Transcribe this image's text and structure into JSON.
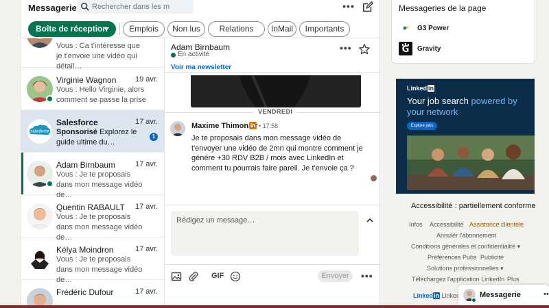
{
  "header": {
    "title": "Messagerie",
    "search_placeholder": "Rechercher dans les m",
    "more_label": "•••"
  },
  "filters": {
    "inbox_label": "Boîte de réception",
    "chips": [
      "Emplois",
      "Non lus",
      "Relations",
      "InMail",
      "Importants"
    ]
  },
  "conversations": [
    {
      "name": "",
      "date": "",
      "preview": "Vous : Ca t'intéresse que je t'envoie une vidéo qui détail…"
    },
    {
      "name": "Virginie Wagnon",
      "date": "19 avr.",
      "preview": "Vous : Hello Virginie, alors comment se passe la prise …"
    },
    {
      "name": "Salesforce",
      "date": "17 avr.",
      "sponsored": "Sponsorisé",
      "preview_rest": "Explorez le guide ultime du…",
      "unread": "1"
    },
    {
      "name": "Adam Birnbaum",
      "date": "17 avr.",
      "preview": "Vous : Je te proposais dans mon message vidéo de…"
    },
    {
      "name": "Quentin RABAULT",
      "date": "17 avr.",
      "preview": "Vous : Je te proposais dans mon message vidéo de…"
    },
    {
      "name": "Kélya Moindron",
      "date": "17 avr.",
      "preview": "Vous : Je te proposais dans mon message vidéo de…"
    },
    {
      "name": "Frédéric Dufour",
      "date": "17 avr.",
      "preview": ""
    }
  ],
  "thread": {
    "name": "Adam Birnbaum",
    "status": "En activité",
    "newsletter_link": "Voir ma newsletter",
    "day_label": "VENDREDI",
    "message": {
      "author": "Maxime Thimonier",
      "badge": "in",
      "time": "• 17:58",
      "body": "Je te proposais dans mon message vidéo de t'envoyer une vidéo de 2mn qui montre comment je génère +30 RDV B2B / mois avec LinkedIn et comment tu pourrais faire pareil. Je t'envoie ça ?"
    },
    "composer_placeholder": "Rédigez un message…",
    "gif_label": "GIF",
    "send_label": "Envoyer"
  },
  "page_messages": {
    "title": "Messageries de la page",
    "items": [
      {
        "name": "G3 Power"
      },
      {
        "name": "Gravity"
      }
    ]
  },
  "ad": {
    "brand": "Linked",
    "brand_in": "in",
    "headline_a": "Your job search ",
    "headline_b": "powered by your network",
    "cta": "Explore jobs"
  },
  "footer": {
    "accessibility": "Accessibilité : partiellement conforme",
    "links": {
      "infos": "Infos",
      "accessibilite": "Accessibilité",
      "assistance": "Assistance clientèle",
      "annuler": "Annuler l'abonnement",
      "conditions": "Conditions générales et confidentialité ▾",
      "preferences": "Préférences Pubs",
      "publicite": "Publicité",
      "solutions": "Solutions professionnelles ▾",
      "telecharger": "Téléchargez l'application LinkedIn",
      "plus": "Plus"
    },
    "brand_linked": "Linked",
    "brand_in": "in",
    "brand_rest": " Linked"
  },
  "mini_bar": {
    "label": "Messagerie",
    "more": "•••"
  },
  "colors": {
    "linkedin_green": "#01754f",
    "linkedin_blue": "#0a66c2",
    "selected_bg": "#dce6f1",
    "ad_bg": "#0b2d49"
  }
}
